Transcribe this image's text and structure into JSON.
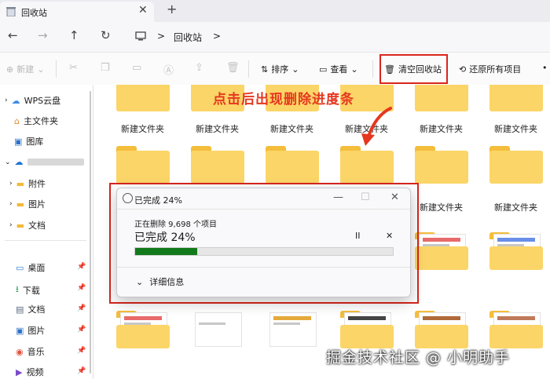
{
  "window": {
    "tab_title": "回收站",
    "close_tab": "✕",
    "new_tab": "+"
  },
  "nav": {
    "back": "←",
    "forward": "→",
    "up": "↑",
    "refresh": "↻",
    "path_sep": ">",
    "breadcrumb": "回收站",
    "crumb_chevron": ">"
  },
  "toolbar": {
    "new": "新建",
    "sort": "排序",
    "view": "查看",
    "empty_recycle_bin": "清空回收站",
    "restore_all": "还原所有项目",
    "more": "•"
  },
  "sidebar": {
    "items": [
      {
        "label": "WPS云盘",
        "icon": "cloud-icon"
      },
      {
        "label": "主文件夹",
        "icon": "home-icon"
      },
      {
        "label": "图库",
        "icon": "gallery-icon"
      },
      {
        "label": "附件",
        "icon": "folder-icon"
      },
      {
        "label": "图片",
        "icon": "folder-icon"
      },
      {
        "label": "文档",
        "icon": "folder-icon"
      },
      {
        "label": "桌面",
        "icon": "desktop-icon"
      },
      {
        "label": "下载",
        "icon": "download-icon"
      },
      {
        "label": "文档",
        "icon": "document-icon"
      },
      {
        "label": "图片",
        "icon": "image-icon"
      },
      {
        "label": "音乐",
        "icon": "music-icon"
      },
      {
        "label": "视频",
        "icon": "video-icon"
      }
    ]
  },
  "folders": {
    "label": "新建文件夹",
    "row1_labels": [
      "新建文件夹",
      "新建文件夹",
      "新建文件夹",
      "新建文件夹",
      "新建文件夹",
      "新建文件夹"
    ],
    "row2_labels": [
      "新建文件夹",
      "新建文件夹"
    ]
  },
  "annotation": "点击后出现删除进度条",
  "dialog": {
    "title": "已完成 24%",
    "subtitle": "正在删除 9,698 个项目",
    "progress_text": "已完成 24%",
    "progress": 0.24,
    "pause": "II",
    "cancel": "✕",
    "details": "详细信息",
    "minimize": "—",
    "maximize": "☐",
    "close": "✕"
  },
  "watermark": "掘金技术社区 @ 小明助手",
  "colors": {
    "highlight": "#d9251c",
    "progress": "#137a1b",
    "folder": "#fbd567"
  }
}
